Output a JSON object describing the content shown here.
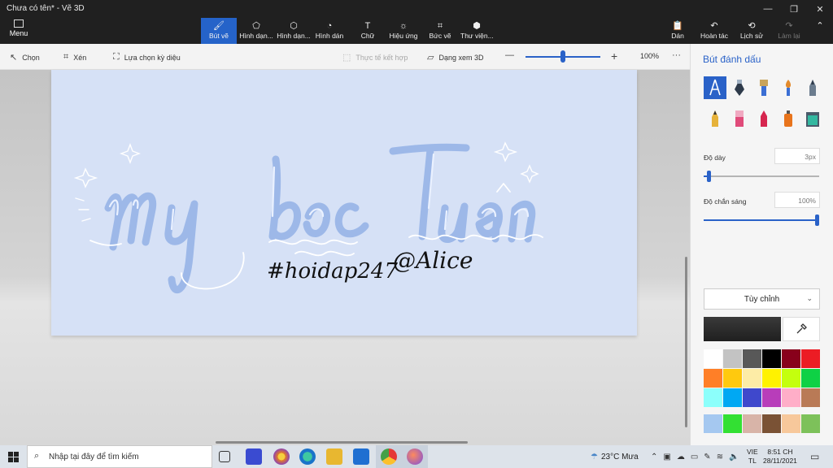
{
  "window": {
    "title": "Chưa có tên* - Vẽ 3D"
  },
  "menu": {
    "label": "Menu"
  },
  "ribbon": {
    "tools": [
      {
        "label": "Bút vẽ"
      },
      {
        "label": "Hình dạn..."
      },
      {
        "label": "Hình dạn..."
      },
      {
        "label": "Hình dán"
      },
      {
        "label": "Chữ"
      },
      {
        "label": "Hiệu ứng"
      },
      {
        "label": "Bức vẽ"
      },
      {
        "label": "Thư viện..."
      }
    ],
    "right": [
      {
        "label": "Dán"
      },
      {
        "label": "Hoàn tác"
      },
      {
        "label": "Lịch sử"
      },
      {
        "label": "Làm lại"
      }
    ]
  },
  "commandbar": {
    "select": "Chọn",
    "crop": "Xén",
    "magic_select": "Lựa chọn kỳ diệu",
    "mixed_reality": "Thực tế kết hợp",
    "view3d": "Dạng xem 3D",
    "zoom": "100%",
    "zoom_level": 0.5
  },
  "panel": {
    "title": "Bút đánh dấu",
    "thickness_label": "Độ dày",
    "thickness_value": "3px",
    "thickness_level": 0.03,
    "opacity_label": "Độ chắn sáng",
    "opacity_value": "100%",
    "opacity_level": 1.0,
    "color_mode": "Tùy chỉnh",
    "current_color": "#1f1f1f",
    "palette": [
      "#ffffff",
      "#c3c3c3",
      "#585858",
      "#000000",
      "#88001b",
      "#ec1c24",
      "#ff7f27",
      "#ffc90e",
      "#fdeca6",
      "#fff200",
      "#c4ff0e",
      "#0ed145",
      "#8cfffb",
      "#00a8f3",
      "#3f48cc",
      "#b83dba",
      "#ffaec8",
      "#b97a56",
      "#a5c8f0",
      "#33e033",
      "#d8b4a8",
      "#7a5235",
      "#f7c89b",
      "#7dc15a"
    ]
  },
  "canvas_text": {
    "signature1": "#hoidap247",
    "signature2": "@Alice"
  },
  "taskbar": {
    "search_placeholder": "Nhập tại đây để tìm kiếm",
    "weather": "23°C  Mưa",
    "lang1": "VIE",
    "lang2": "TL",
    "time": "8:51 CH",
    "date": "28/11/2021"
  }
}
